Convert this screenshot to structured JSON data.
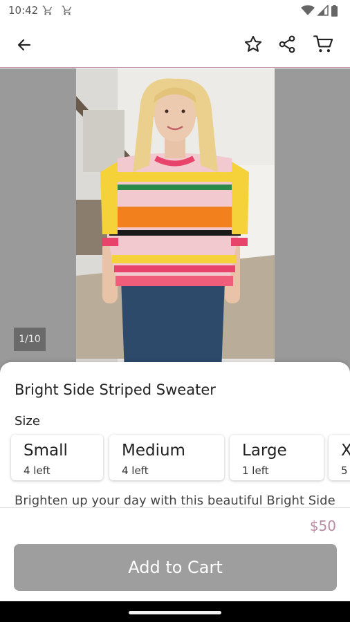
{
  "status_bar": {
    "time": "10:42",
    "notification_icons": [
      "cart-icon",
      "cart-icon"
    ],
    "right_icons": [
      "wifi-icon",
      "signal-icon",
      "battery-icon"
    ]
  },
  "app_bar": {
    "icons": [
      "arrow-left-icon",
      "star-icon",
      "share-icon",
      "cart-icon"
    ]
  },
  "gallery": {
    "page_indicator": "1/10"
  },
  "product": {
    "title": "Bright Side Striped Sweater",
    "size_label": "Size",
    "sizes": [
      {
        "name": "Small",
        "stock": "4 left"
      },
      {
        "name": "Medium",
        "stock": "4 left"
      },
      {
        "name": "Large",
        "stock": "1 left"
      },
      {
        "name": "X",
        "stock": "5"
      }
    ],
    "description": "Brighten up your day with this beautiful Bright Side",
    "price": "$50",
    "add_to_cart_label": "Add to Cart"
  },
  "colors": {
    "accent": "#b98aa3",
    "button": "#9e9e9e"
  }
}
